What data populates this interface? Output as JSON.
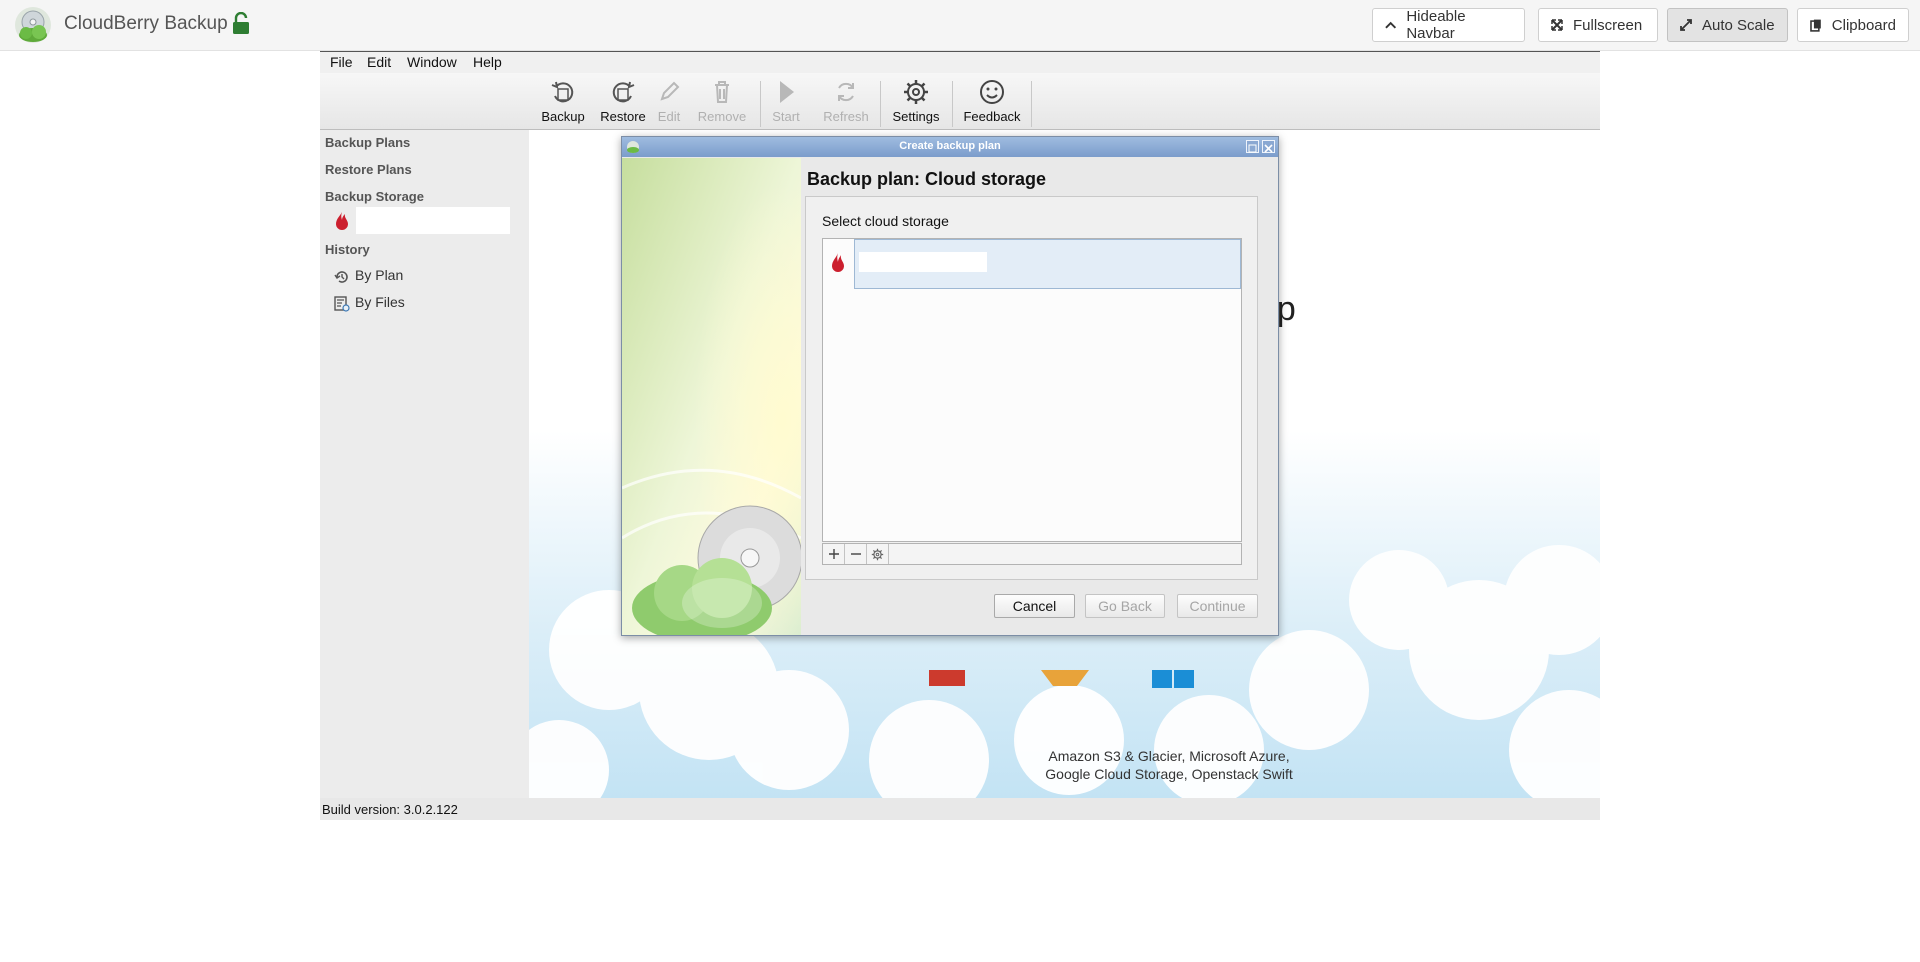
{
  "navbar": {
    "title": "CloudBerry Backup",
    "buttons": {
      "hideable": "Hideable Navbar",
      "fullscreen": "Fullscreen",
      "autoscale": "Auto Scale",
      "clipboard": "Clipboard"
    }
  },
  "menu": {
    "file": "File",
    "edit": "Edit",
    "window": "Window",
    "help": "Help"
  },
  "toolbar": {
    "backup": "Backup",
    "restore": "Restore",
    "edit": "Edit",
    "remove": "Remove",
    "start": "Start",
    "refresh": "Refresh",
    "settings": "Settings",
    "feedback": "Feedback"
  },
  "sidebar": {
    "backup_plans": "Backup Plans",
    "restore_plans": "Restore Plans",
    "backup_storage": "Backup Storage",
    "history": "History",
    "by_plan": "By Plan",
    "by_files": "By Files"
  },
  "content": {
    "welcome_fragment": "up",
    "cloud_line1": "Amazon S3 & Glacier, Microsoft Azure,",
    "cloud_line2": "Google Cloud Storage, Openstack Swift"
  },
  "dialog": {
    "window_title": "Create backup plan",
    "heading": "Backup plan: Cloud storage",
    "select_label": "Select cloud storage",
    "cancel": "Cancel",
    "go_back": "Go Back",
    "continue": "Continue"
  },
  "status": {
    "build": "Build version: 3.0.2.122"
  },
  "colors": {
    "accent_green": "#2e7d32",
    "storage_red": "#cc1f2e",
    "titlebar_blue": "#7b9ccb"
  }
}
